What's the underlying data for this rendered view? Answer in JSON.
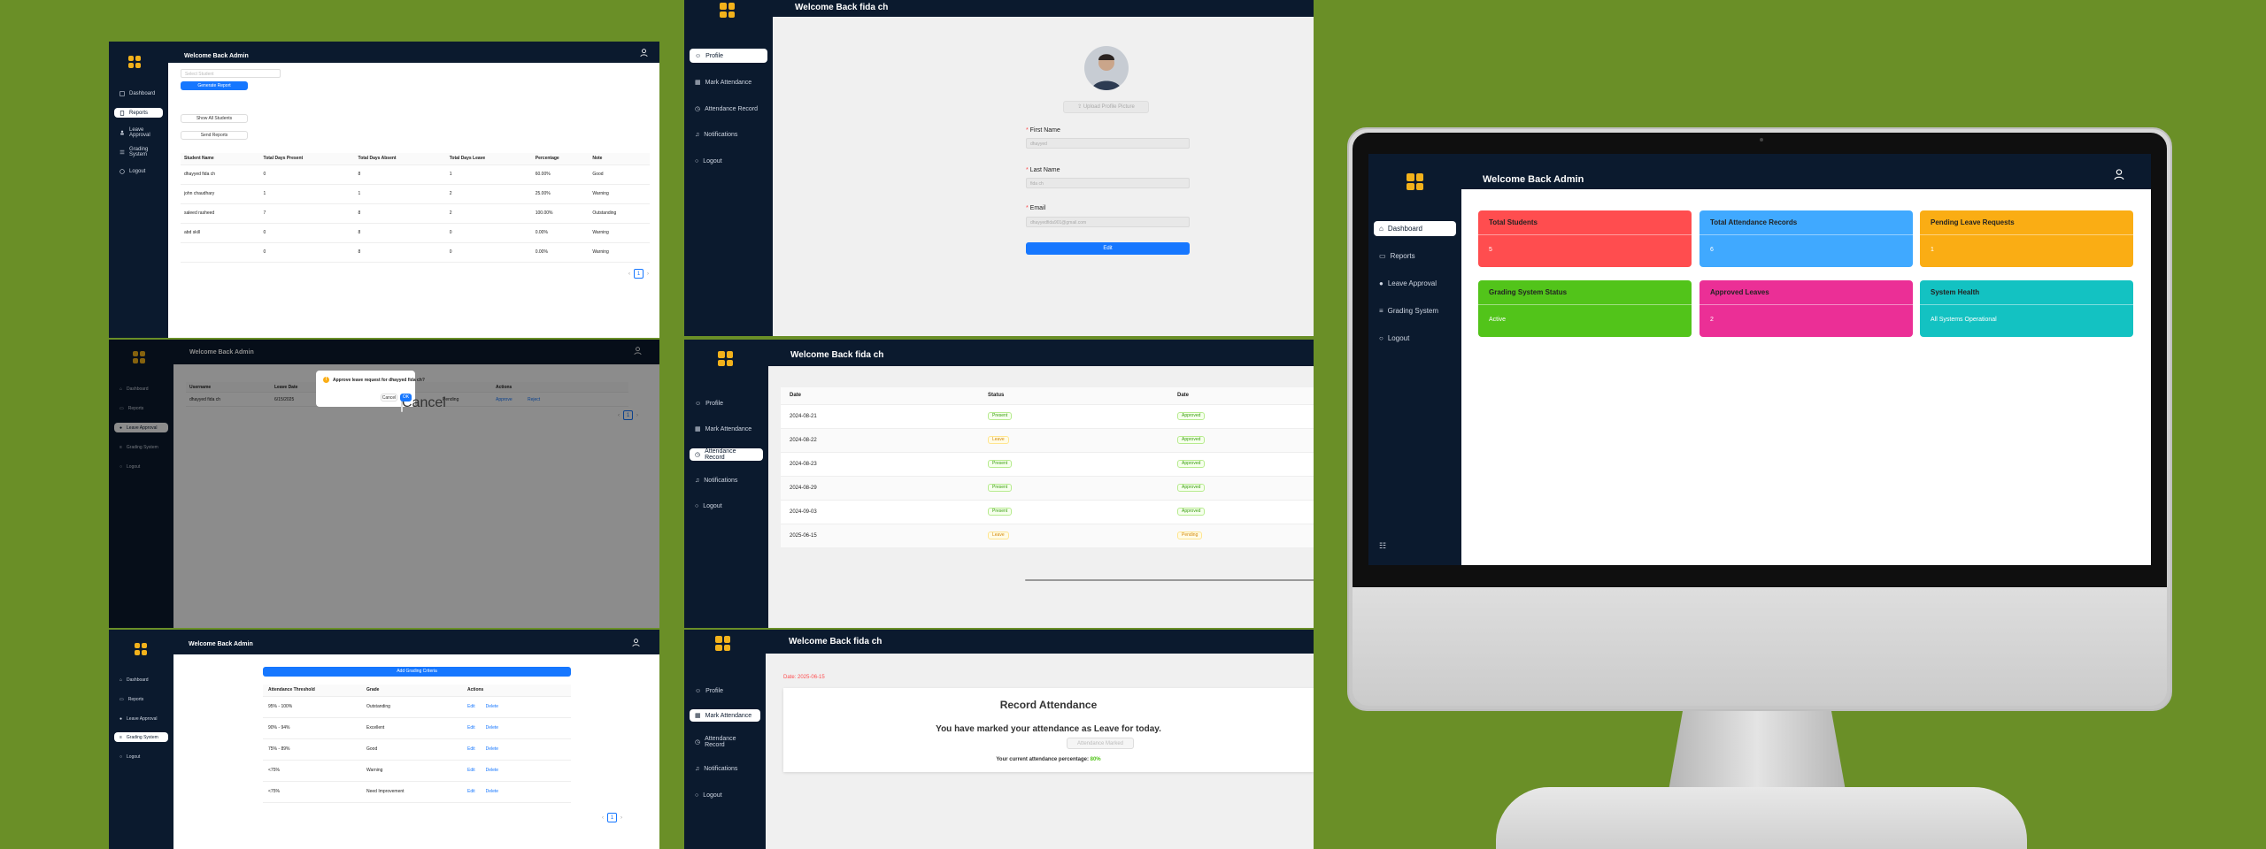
{
  "admin": {
    "welcome": "Welcome Back Admin",
    "nav": [
      "Dashboard",
      "Reports",
      "Leave Approval",
      "Grading System",
      "Logout"
    ]
  },
  "student": {
    "welcome": "Welcome Back fida ch",
    "nav": [
      "Profile",
      "Mark Attendance",
      "Attendance Record",
      "Notifications",
      "Logout"
    ]
  },
  "reports": {
    "search_placeholder": "Select Student",
    "generate_label": "Generate Report",
    "show_all_label": "Show All Students",
    "send_label": "Send Reports",
    "columns": [
      "Student Name",
      "Total Days Present",
      "Total Days Absent",
      "Total Days Leave",
      "Percentage",
      "Note"
    ],
    "rows": [
      [
        "dhayyed fida ch",
        "0",
        "8",
        "1",
        "60.00%",
        "Good"
      ],
      [
        "john chaudhary",
        "1",
        "1",
        "2",
        "25.00%",
        "Warning"
      ],
      [
        "saleed rasheed",
        "7",
        "8",
        "2",
        "100.00%",
        "Outstanding"
      ],
      [
        "abd skill",
        "0",
        "8",
        "0",
        "0.00%",
        "Warning"
      ],
      [
        "",
        "0",
        "8",
        "0",
        "0.00%",
        "Warning"
      ]
    ],
    "page": "1"
  },
  "leave": {
    "modal_title": "Approve leave request for dhayyed fida ch?",
    "cancel_label": "Cancel",
    "ok_label": "OK",
    "col_username": "Username",
    "col_leave_date": "Leave Date",
    "col_actions": "Actions",
    "row_user": "dhayyed fida ch",
    "row_date": "6/15/2025",
    "row_status": "Pending",
    "approve_label": "Approve",
    "reject_label": "Reject",
    "page": "1"
  },
  "grading": {
    "add_label": "Add Grading Criteria",
    "columns": [
      "Attendance Threshold",
      "Grade",
      "Actions"
    ],
    "rows": [
      [
        "95% - 100%",
        "Outstanding"
      ],
      [
        "90% - 94%",
        "Excellent"
      ],
      [
        "75% - 89%",
        "Good"
      ],
      [
        "<75%",
        "Warning"
      ],
      [
        "<75%",
        "Need Improvement"
      ]
    ],
    "edit_label": "Edit",
    "delete_label": "Delete",
    "page": "1"
  },
  "profile": {
    "upload_label": "Upload Profile Picture",
    "first_name_label": "First Name",
    "first_name_value": "dhayyed",
    "last_name_label": "Last Name",
    "last_name_value": "fida ch",
    "email_label": "Email",
    "email_value": "dhayyedfida901@gmail.com",
    "edit_label": "Edit"
  },
  "record": {
    "columns": [
      "Date",
      "Status",
      "Date"
    ],
    "rows": [
      [
        "2024-08-21",
        "Present",
        "Approved"
      ],
      [
        "2024-08-22",
        "Leave",
        "Approved"
      ],
      [
        "2024-08-23",
        "Present",
        "Approved"
      ],
      [
        "2024-08-29",
        "Present",
        "Approved"
      ],
      [
        "2024-09-03",
        "Present",
        "Approved"
      ],
      [
        "2025-06-15",
        "Leave",
        "Pending"
      ]
    ]
  },
  "mark": {
    "date_label": "Date: 2025-06-15",
    "heading": "Record Attendance",
    "message": "You have marked your attendance as Leave for today.",
    "marked_label": "Attendance Marked",
    "percentage_text": "Your current attendance percentage:",
    "percentage_value": "80%"
  },
  "dashboard": {
    "cards": [
      {
        "title": "Total Students",
        "value": "5",
        "color": "#ff4d4f"
      },
      {
        "title": "Total Attendance Records",
        "value": "6",
        "color": "#40a9ff"
      },
      {
        "title": "Pending Leave Requests",
        "value": "1",
        "color": "#faad14"
      },
      {
        "title": "Grading System Status",
        "value": "Active",
        "color": "#52c41a"
      },
      {
        "title": "Approved Leaves",
        "value": "2",
        "color": "#eb2f96"
      },
      {
        "title": "System Health",
        "value": "All Systems Operational",
        "color": "#13c2c2"
      }
    ]
  },
  "colors": {
    "background": "#6a8f27",
    "sidebar": "#0b1a2e",
    "accent": "#1677ff",
    "logo": "#f3b21b"
  }
}
